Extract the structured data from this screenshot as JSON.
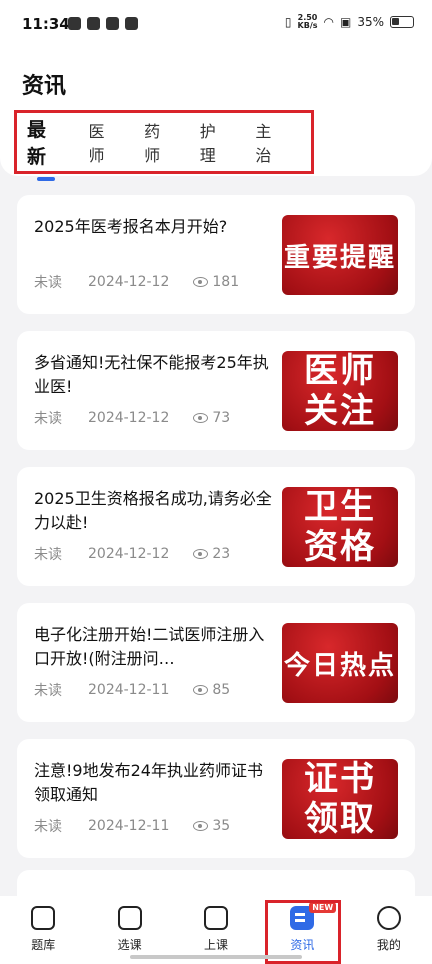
{
  "status": {
    "time": "11:34",
    "speed_value": "2.50",
    "speed_unit": "KB/s",
    "battery": "35%"
  },
  "page": {
    "title": "资讯"
  },
  "tabs": [
    "最新",
    "医师",
    "药师",
    "护理",
    "主治"
  ],
  "articles": [
    {
      "title": "2025年医考报名本月开始?",
      "status": "未读",
      "date": "2024-12-12",
      "views": "181",
      "thumb": "重要提醒"
    },
    {
      "title": "多省通知!无社保不能报考25年执业医!",
      "status": "未读",
      "date": "2024-12-12",
      "views": "73",
      "thumb": "医师关注"
    },
    {
      "title": "2025卫生资格报名成功,请务必全力以赴!",
      "status": "未读",
      "date": "2024-12-12",
      "views": "23",
      "thumb": "卫生资格"
    },
    {
      "title": "电子化注册开始!二试医师注册入口开放!(附注册问…",
      "status": "未读",
      "date": "2024-12-11",
      "views": "85",
      "thumb": "今日热点"
    },
    {
      "title": "注意!9地发布24年执业药师证书领取通知",
      "status": "未读",
      "date": "2024-12-11",
      "views": "35",
      "thumb": "证书领取"
    }
  ],
  "bottom_nav": [
    "题库",
    "选课",
    "上课",
    "资讯",
    "我的"
  ],
  "badge": "NEW",
  "colors": {
    "accent": "#2f6ae6",
    "highlight": "#d9232a"
  }
}
